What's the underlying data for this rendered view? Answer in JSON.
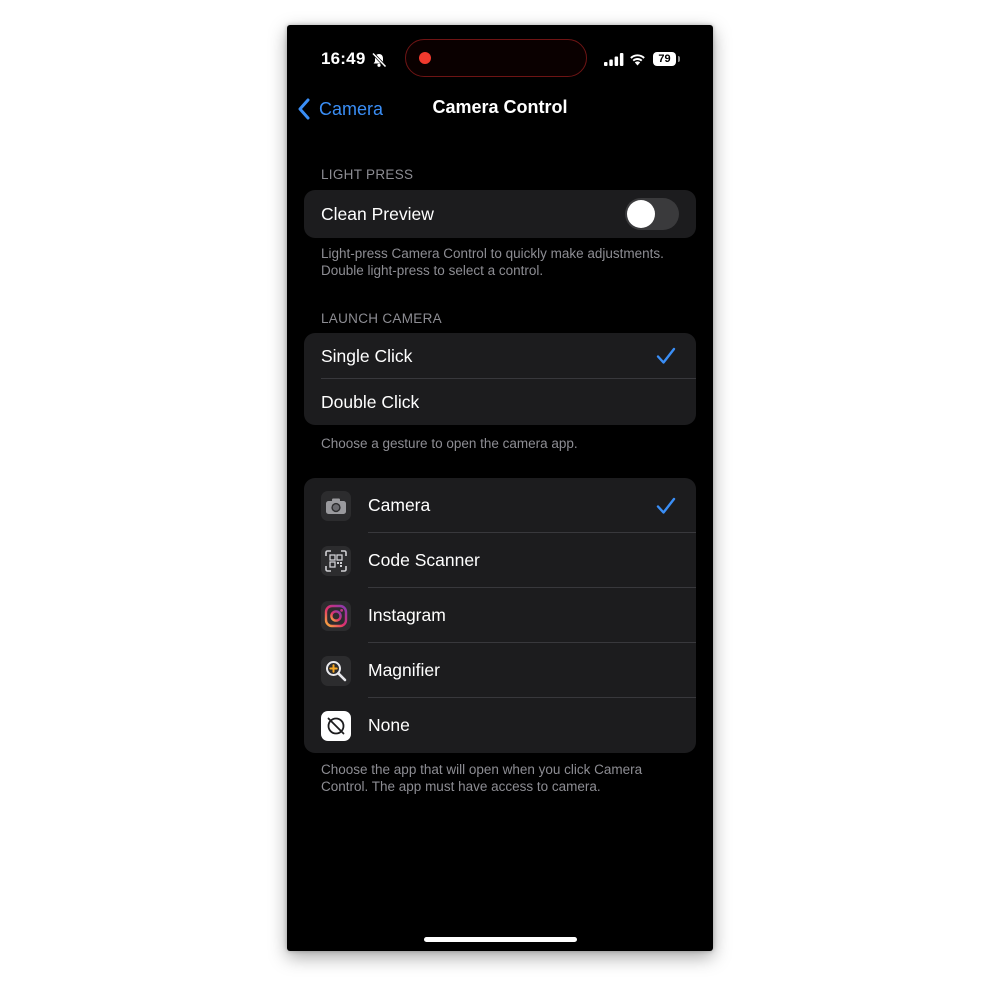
{
  "status_bar": {
    "time": "16:49",
    "battery": "79"
  },
  "nav": {
    "back_label": "Camera",
    "title": "Camera Control"
  },
  "light_press": {
    "header": "LIGHT PRESS",
    "clean_preview_label": "Clean Preview",
    "clean_preview_on": false,
    "footer": "Light-press Camera Control to quickly make adjustments. Double light-press to select a control."
  },
  "launch_camera": {
    "header": "LAUNCH CAMERA",
    "options": [
      {
        "label": "Single Click",
        "selected": true
      },
      {
        "label": "Double Click",
        "selected": false
      }
    ],
    "footer": "Choose a gesture to open the camera app."
  },
  "apps": {
    "items": [
      {
        "label": "Camera",
        "icon": "camera-icon",
        "selected": true
      },
      {
        "label": "Code Scanner",
        "icon": "qr-code-icon",
        "selected": false
      },
      {
        "label": "Instagram",
        "icon": "instagram-icon",
        "selected": false
      },
      {
        "label": "Magnifier",
        "icon": "magnifier-icon",
        "selected": false
      },
      {
        "label": "None",
        "icon": "none-icon",
        "selected": false
      }
    ],
    "footer": "Choose the app that will open when you click Camera Control. The app must have access to camera."
  },
  "colors": {
    "accent": "#3a8ef6",
    "background": "#000000",
    "cell": "#1c1c1e",
    "secondary_text": "#8d8d93",
    "recording": "#f03a2e"
  }
}
